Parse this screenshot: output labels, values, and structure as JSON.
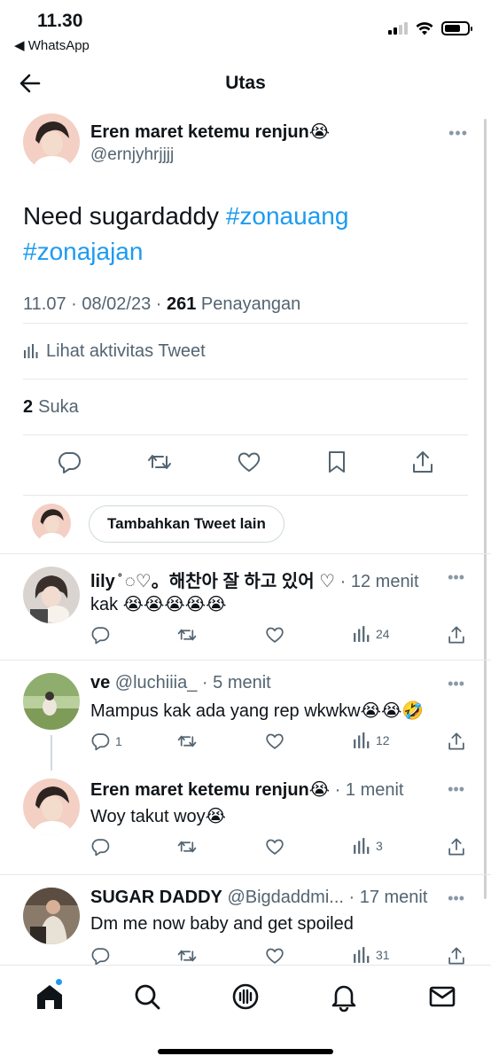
{
  "status_bar": {
    "time": "11.30",
    "back_app": "◀ WhatsApp"
  },
  "nav": {
    "title": "Utas"
  },
  "tweet": {
    "author_name": "Eren maret ketemu renjun😭",
    "author_handle": "@ernjyhrjjjj",
    "text_plain": "Need sugardaddy ",
    "hashtag_1": "#zonauang",
    "hashtag_2": "#zonajajan",
    "time_date": "11.07 · 08/02/23 · ",
    "views_count": "261",
    "views_label": " Penayangan",
    "activity_link": "Lihat aktivitas Tweet",
    "likes_count": "2",
    "likes_label": "Suka"
  },
  "compose": {
    "button_label": "Tambahkan Tweet lain"
  },
  "replies": [
    {
      "name": "lily ̊ ◌♡。해찬아 잘 하고 있어 ♡",
      "handle": "",
      "time": " · 12 menit",
      "text": "kak 😭😭😭😭😭",
      "reply_count": "",
      "views": "24"
    },
    {
      "name": "ve",
      "handle": " @luchiiia_",
      "time": " · 5 menit",
      "text": "Mampus kak ada yang rep wkwkw😭😭🤣",
      "reply_count": "1",
      "views": "12"
    },
    {
      "name": "Eren maret ketemu renjun😭",
      "handle": "",
      "time": " · 1 menit",
      "text": "Woy takut woy😭",
      "reply_count": "",
      "views": "3"
    },
    {
      "name": "SUGAR DADDY",
      "handle": " @Bigdaddmi...",
      "time": " · 17 menit",
      "text": "Dm me now baby and get spoiled",
      "reply_count": "",
      "views": "31"
    }
  ],
  "icons": {
    "back": "arrow-left-icon",
    "reply": "reply-icon",
    "retweet": "retweet-icon",
    "like": "heart-icon",
    "bookmark": "bookmark-icon",
    "share": "share-icon",
    "views": "views-icon",
    "home": "home-icon",
    "search": "search-icon",
    "spaces": "spaces-icon",
    "notifications": "bell-icon",
    "messages": "mail-icon"
  },
  "colors": {
    "accent": "#1d9bf0",
    "secondary_text": "#536471",
    "divider": "#e4e8ea"
  }
}
